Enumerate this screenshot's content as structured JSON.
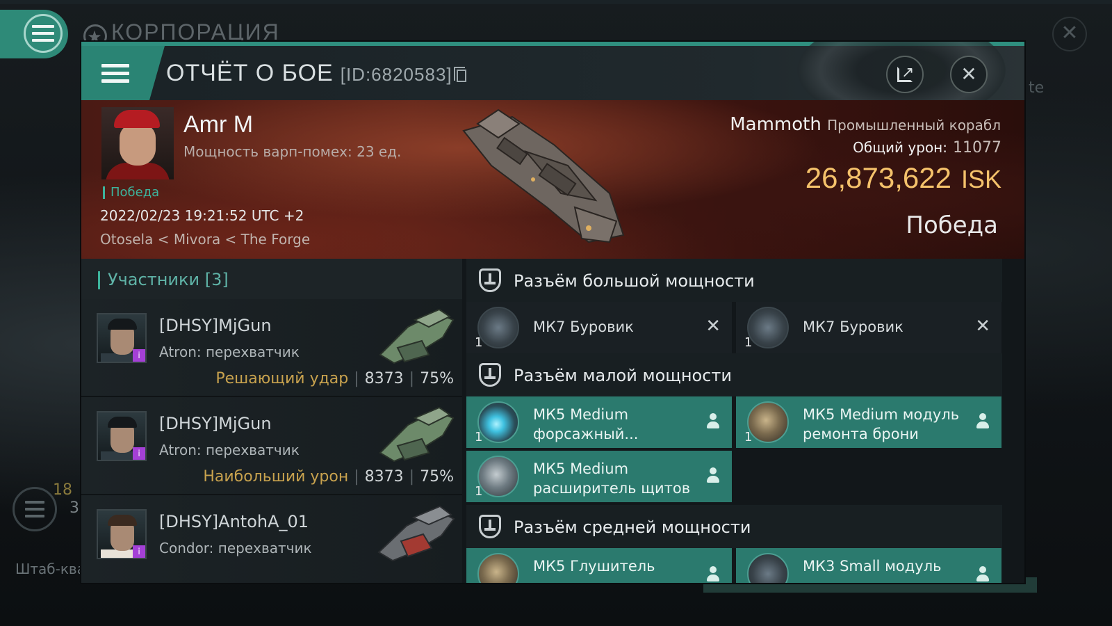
{
  "background": {
    "title": "КОРПОРАЦИЯ",
    "side_text": "te",
    "count_a": "18",
    "count_b": "3",
    "hq_label": "Штаб-ква"
  },
  "report": {
    "title": "ОТЧЁТ О БОЕ",
    "id_label": "[ID:6820583]",
    "icons": [
      "menu-icon",
      "copy-icon",
      "export-icon",
      "close-icon"
    ]
  },
  "victim": {
    "name": "Amr M",
    "warp_strength": "Мощность варп-помех: 23 ед.",
    "tag": "Победа",
    "timestamp": "2022/02/23 19:21:52 UTC +2",
    "location": "Otosela < Mivora < The Forge",
    "ship_name": "Mammoth",
    "ship_class": "Промышленный корабл",
    "total_damage_label": "Общий урон:",
    "total_damage_value": "11077",
    "isk_value": "26,873,622",
    "isk_currency": "ISK",
    "result": "Победа"
  },
  "participants": {
    "header": "Участники [3]",
    "rows": [
      {
        "name": "[DHSY]MjGun",
        "ship": "Atron: перехватчик",
        "label": "Решающий удар",
        "damage": "8373",
        "percent": "75%"
      },
      {
        "name": "[DHSY]MjGun",
        "ship": "Atron: перехватчик",
        "label": "Наибольший урон",
        "damage": "8373",
        "percent": "75%"
      },
      {
        "name": "[DHSY]AntohA_01",
        "ship": "Condor: перехватчик",
        "label": "",
        "damage": "",
        "percent": ""
      }
    ]
  },
  "fitting": {
    "high_slots_title": "Разъём большой мощности",
    "low_slots_title": "Разъём малой мощности",
    "mid_slots_title": "Разъём средней мощности",
    "high": [
      {
        "name": "МК7 Буровик",
        "qty": "1"
      },
      {
        "name": "МК7 Буровик",
        "qty": "1"
      }
    ],
    "low": [
      {
        "name_l1": "МК5 Medium",
        "name_l2": "форсажный...",
        "qty": "1"
      },
      {
        "name_l1": "МК5 Medium модуль",
        "name_l2": "ремонта брони",
        "qty": "1"
      },
      {
        "name_l1": "МК5 Medium",
        "name_l2": "расширитель щитов",
        "qty": "1"
      }
    ],
    "mid": [
      {
        "name": "МК5 Глушитель"
      },
      {
        "name": "МК3 Small модуль"
      }
    ]
  },
  "colors": {
    "accent": "#2e8a78",
    "isk": "#f5c26b",
    "victory": "#3db39c",
    "final_blow": "#c8a24e"
  }
}
